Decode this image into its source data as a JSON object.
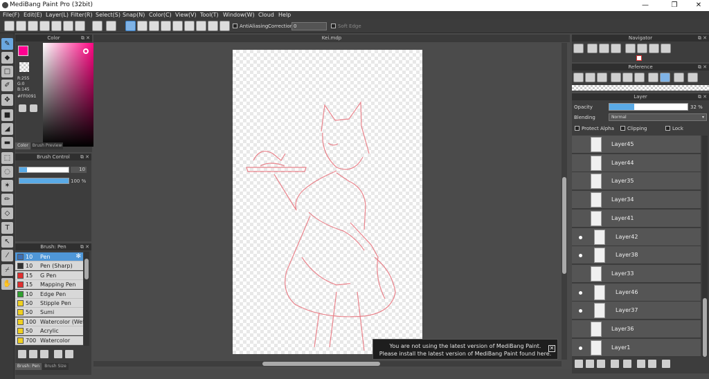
{
  "window": {
    "title": "MediBang Paint Pro (32bit)",
    "minimize": "—",
    "maximize": "❐",
    "close": "✕"
  },
  "menu": [
    "File(F)",
    "Edit(E)",
    "Layer(L)",
    "Filter(R)",
    "Select(S)",
    "Snap(N)",
    "Color(C)",
    "View(V)",
    "Tool(T)",
    "Window(W)",
    "Cloud",
    "Help"
  ],
  "toolbar": {
    "antialiasing_label": "AntiAliasing",
    "correction_label": "Correction",
    "correction_value": "0",
    "soft_edge_label": "Soft Edge"
  },
  "color_panel": {
    "title": "Color",
    "rgb": {
      "r": "R:255",
      "g": "G:0",
      "b": "B:145"
    },
    "hex": "#FF0091",
    "primary_color": "#FF0091",
    "tab_color": "Color",
    "tab_brush_preview": "Brush Preview"
  },
  "brush_control": {
    "title": "Brush Control",
    "size_value": "10",
    "opacity_value": "100 %",
    "opacity_fraction": 1.0
  },
  "brush_list": {
    "title": "Brush: Pen",
    "items": [
      {
        "size": "10",
        "name": "Pen",
        "color": "#3b6fb5"
      },
      {
        "size": "10",
        "name": "Pen (Sharp)",
        "color": "#333333"
      },
      {
        "size": "15",
        "name": "G Pen",
        "color": "#e03030"
      },
      {
        "size": "15",
        "name": "Mapping Pen",
        "color": "#e03030"
      },
      {
        "size": "10",
        "name": "Edge Pen",
        "color": "#30a030"
      },
      {
        "size": "50",
        "name": "Stipple Pen",
        "color": "#f0d020"
      },
      {
        "size": "50",
        "name": "Sumi",
        "color": "#f0d020"
      },
      {
        "size": "100",
        "name": "Watercolor (Wet",
        "color": "#f0d020"
      },
      {
        "size": "50",
        "name": "Acrylic",
        "color": "#f0d020"
      },
      {
        "size": "700",
        "name": "Watercolor",
        "color": "#f0d020"
      }
    ],
    "tab_brush": "Brush: Pen",
    "tab_brush_size": "Brush Size"
  },
  "canvas": {
    "tab_title": "Kei.mdp",
    "notice_line1": "You are not using the latest version of MediBang Paint.",
    "notice_line2": "Please install the latest version of MediBang Paint found here."
  },
  "navigator": {
    "title": "Navigator"
  },
  "reference": {
    "title": "Reference"
  },
  "layer_panel": {
    "title": "Layer",
    "opacity_label": "Opacity",
    "opacity_value": "32 %",
    "opacity_fraction": 0.32,
    "blending_label": "Blending",
    "blending_value": "Normal",
    "protect_alpha": "Protect Alpha",
    "clipping": "Clipping",
    "lock": "Lock",
    "layers": [
      {
        "name": "Layer45",
        "indent": false,
        "visible": false
      },
      {
        "name": "Layer44",
        "indent": false,
        "visible": false
      },
      {
        "name": "Layer35",
        "indent": false,
        "visible": false
      },
      {
        "name": "Layer34",
        "indent": false,
        "visible": false
      },
      {
        "name": "Layer41",
        "indent": false,
        "visible": false
      },
      {
        "name": "Layer42",
        "indent": true,
        "visible": true
      },
      {
        "name": "Layer38",
        "indent": true,
        "visible": true
      },
      {
        "name": "Layer33",
        "indent": false,
        "visible": false
      },
      {
        "name": "Layer46",
        "indent": true,
        "visible": true
      },
      {
        "name": "Layer37",
        "indent": true,
        "visible": true
      },
      {
        "name": "Layer36",
        "indent": false,
        "visible": false
      },
      {
        "name": "Layer1",
        "indent": false,
        "visible": true
      }
    ]
  }
}
